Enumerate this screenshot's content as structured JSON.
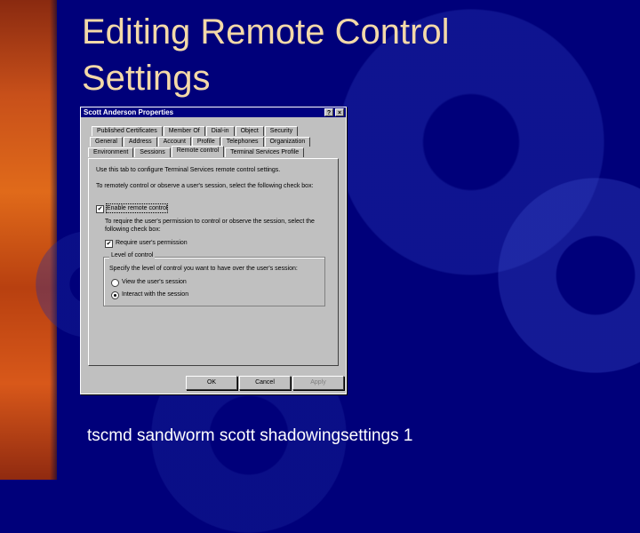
{
  "slide": {
    "title": "Editing Remote Control Settings",
    "caption": "tscmd sandworm scott shadowingsettings 1"
  },
  "dialog": {
    "title": "Scott Anderson Properties",
    "help_glyph": "?",
    "close_glyph": "×",
    "tabs_row1": [
      "Published Certificates",
      "Member Of",
      "Dial-in",
      "Object",
      "Security"
    ],
    "tabs_row2": [
      "General",
      "Address",
      "Account",
      "Profile",
      "Telephones",
      "Organization"
    ],
    "tabs_row3": [
      "Environment",
      "Sessions",
      "Remote control",
      "Terminal Services Profile"
    ],
    "active_tab": "Remote control",
    "intro_text": "Use this tab to configure Terminal Services remote control settings.",
    "control_text": "To remotely control or observe a user's session, select the following check box:",
    "enable_label": "Enable remote control",
    "enable_checked": "✔",
    "permission_text": "To require the user's permission to control or observe the session, select the following check box:",
    "require_label": "Require user's permission",
    "require_checked": "✔",
    "level_legend": "Level of control",
    "level_text": "Specify the level of control you want to have over the user's session:",
    "option_view": "View the user's session",
    "option_interact": "Interact with the session",
    "selected_option": "Interact with the session",
    "ok_label": "OK",
    "cancel_label": "Cancel",
    "apply_label": "Apply"
  },
  "colors": {
    "background": "#00007a",
    "title_text": "#f3d9a8",
    "dialog_face": "#c0c0c0",
    "titlebar": "#000080"
  }
}
